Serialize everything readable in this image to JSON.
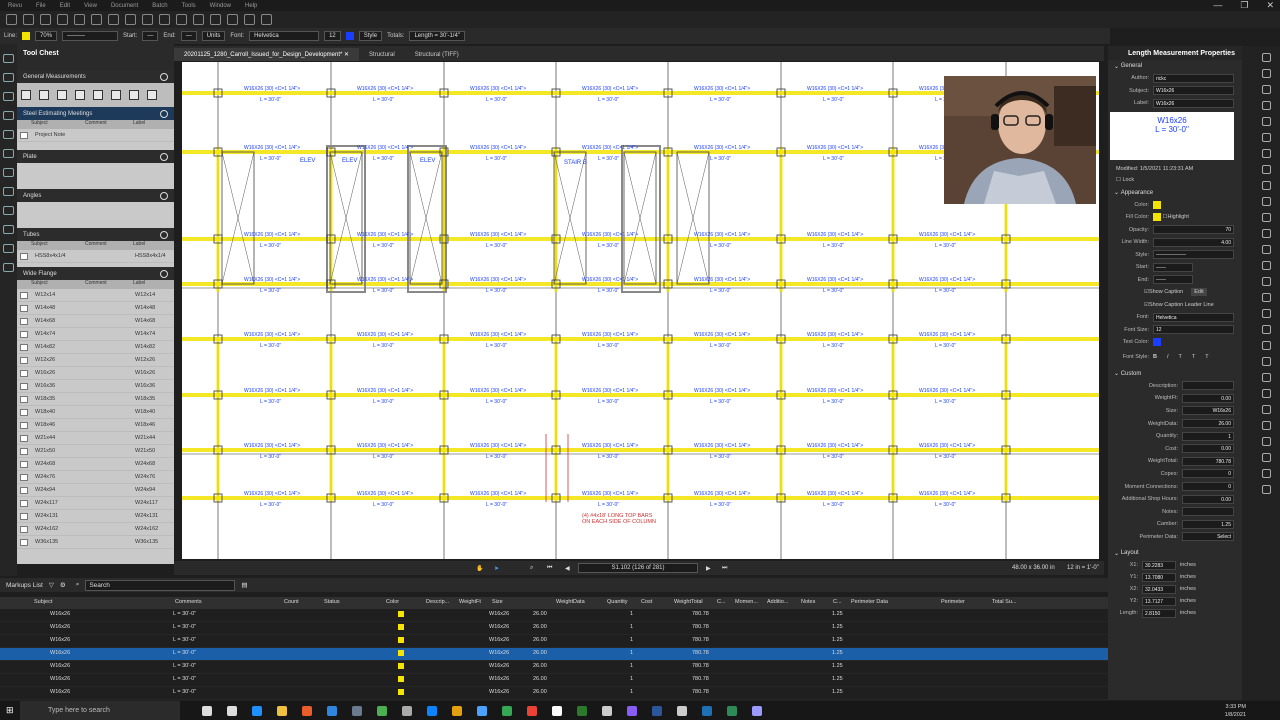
{
  "app": {
    "name": "Revu"
  },
  "menu": [
    "Revu",
    "File",
    "Edit",
    "View",
    "Document",
    "Batch",
    "Tools",
    "Window",
    "Help"
  ],
  "window": {
    "minimize": "—",
    "restore": "❐",
    "close": "✕"
  },
  "propbar": {
    "line_label": "Line:",
    "line_color": "#f2e400",
    "opacity": "70%",
    "start_label": "Start:",
    "end_label": "End:",
    "units": "Units",
    "font_label": "Font:",
    "font": "Helvetica",
    "font_size": "12",
    "style": "Style",
    "totals_label": "Totals:",
    "totals_value": "Length = 30'-1/4\""
  },
  "toolchest": {
    "title": "Tool Chest",
    "sections": [
      {
        "name": "General Measurements"
      },
      {
        "name": "Steel Estimating Meetings"
      },
      {
        "name": "Plate"
      },
      {
        "name": "Angles"
      },
      {
        "name": "Tubes"
      },
      {
        "name": "Wide Flange"
      }
    ],
    "col_subject": "Subject",
    "col_comment": "Comment",
    "col_label": "Label",
    "steel_rows": [
      {
        "subject": "Project Note",
        "label": ""
      }
    ],
    "tube_rows": [
      {
        "subject": "HSS8x4x1/4",
        "label": "HSS8x4x1/4"
      }
    ],
    "wf_rows": [
      {
        "subject": "W12x14",
        "label": "W12x14"
      },
      {
        "subject": "W14x48",
        "label": "W14x48"
      },
      {
        "subject": "W14x68",
        "label": "W14x68"
      },
      {
        "subject": "W14x74",
        "label": "W14x74"
      },
      {
        "subject": "W14x82",
        "label": "W14x82"
      },
      {
        "subject": "W12x26",
        "label": "W12x26"
      },
      {
        "subject": "W16x26",
        "label": "W16x26"
      },
      {
        "subject": "W16x36",
        "label": "W16x36"
      },
      {
        "subject": "W18x35",
        "label": "W18x35"
      },
      {
        "subject": "W18x40",
        "label": "W18x40"
      },
      {
        "subject": "W18x46",
        "label": "W18x46"
      },
      {
        "subject": "W21x44",
        "label": "W21x44"
      },
      {
        "subject": "W21x50",
        "label": "W21x50"
      },
      {
        "subject": "W24x68",
        "label": "W24x68"
      },
      {
        "subject": "W24x76",
        "label": "W24x76"
      },
      {
        "subject": "W24x94",
        "label": "W24x94"
      },
      {
        "subject": "W24x117",
        "label": "W24x117"
      },
      {
        "subject": "W24x131",
        "label": "W24x131"
      },
      {
        "subject": "W24x162",
        "label": "W24x162"
      },
      {
        "subject": "W36x135",
        "label": "W36x135"
      }
    ]
  },
  "tabs": [
    "20201125_1280_Carroll_Issued_for_Design_Development*",
    "Structural",
    "Structural (TIFF)"
  ],
  "drawing": {
    "beam_label": "W16X26 (30) <C=1 1/4\">",
    "length_label": "L = 30'-0\"",
    "note_line1": "(4) #4x18' LONG TOP BARS",
    "note_line2": "ON EACH SIDE OF COLUMN",
    "elev": "ELEV",
    "stair": "STAIR B"
  },
  "nav": {
    "page": "S1.102 (126 of 281)",
    "size": "48.00 x 36.00 in",
    "scale": "12 in = 1'-0\""
  },
  "props": {
    "title": "Length Measurement Properties",
    "general": "General",
    "author_label": "Author:",
    "author": "rickc",
    "subject_label": "Subject:",
    "subject": "W16x26",
    "label_label": "Label:",
    "label": "W16x26",
    "preview_line1": "W16x26",
    "preview_line2": "L = 30'-0\"",
    "modified": "Modified: 1/5/2021 11:23:31 AM",
    "lock": "Lock",
    "appearance": "Appearance",
    "color_label": "Color:",
    "color": "#f2e400",
    "fill_label": "Fill Color:",
    "highlight": "Highlight",
    "opacity_label": "Opacity:",
    "opacity": "70",
    "linewidth_label": "Line Width:",
    "linewidth": "4.00",
    "style_label": "Style:",
    "start_label": "Start:",
    "end_label": "End:",
    "caption": "Show Caption",
    "edit": "Edit",
    "leader": "Show Caption Leader Line",
    "font_label": "Font:",
    "font": "Helvetica",
    "fontsize_label": "Font Size:",
    "fontsize": "12",
    "textcolor_label": "Text Color:",
    "textcolor": "#1a3dff",
    "fontstyle_label": "Font Style:",
    "custom": "Custom",
    "custom_rows": [
      {
        "label": "Description:",
        "value": ""
      },
      {
        "label": "WeightFt:",
        "value": "0.00"
      },
      {
        "label": "Size:",
        "value": "W16x26"
      },
      {
        "label": "WeightData:",
        "value": "26.00"
      },
      {
        "label": "Quantity:",
        "value": "1"
      },
      {
        "label": "Cost:",
        "value": "0.00"
      },
      {
        "label": "WeightTotal:",
        "value": "780.78"
      },
      {
        "label": "Copes:",
        "value": "0"
      },
      {
        "label": "Moment Connections:",
        "value": "0"
      },
      {
        "label": "Additional Shop Hours:",
        "value": "0.00"
      },
      {
        "label": "Notes:",
        "value": ""
      },
      {
        "label": "Camber:",
        "value": "1.25"
      },
      {
        "label": "Perimeter Data:",
        "value": "Select"
      }
    ],
    "layout": "Layout",
    "layout_rows": [
      {
        "label": "X1:",
        "value": "30.2283",
        "unit": "inches"
      },
      {
        "label": "Y1:",
        "value": "13.7080",
        "unit": "inches"
      },
      {
        "label": "X2:",
        "value": "32.0433",
        "unit": "inches"
      },
      {
        "label": "Y2:",
        "value": "13.7127",
        "unit": "inches"
      },
      {
        "label": "Length:",
        "value": "2.8150",
        "unit": "inches"
      }
    ]
  },
  "markups": {
    "title": "Markups List",
    "search_placeholder": "Search",
    "columns": [
      "Subject",
      "Comments",
      "Count",
      "Status",
      "Color",
      "Descrip...",
      "WeightFt",
      "Size",
      "WeightData",
      "Quantity",
      "Cost",
      "WeightTotal",
      "C...",
      "Momen...",
      "Additio...",
      "Notes",
      "C...",
      "Perimeter Data",
      "Perimeter",
      "Total Su..."
    ],
    "rows": [
      {
        "subject": "W16x26",
        "comments": "L = 30'-0\"",
        "size": "W16x26",
        "wd": "26.00",
        "qty": "1",
        "wt": "780.78",
        "camber": "1.25",
        "sel": false
      },
      {
        "subject": "W16x26",
        "comments": "L = 30'-0\"",
        "size": "W16x26",
        "wd": "26.00",
        "qty": "1",
        "wt": "780.78",
        "camber": "1.25",
        "sel": false
      },
      {
        "subject": "W16x26",
        "comments": "L = 30'-0\"",
        "size": "W16x26",
        "wd": "26.00",
        "qty": "1",
        "wt": "780.78",
        "camber": "1.25",
        "sel": false
      },
      {
        "subject": "W16x26",
        "comments": "L = 30'-0\"",
        "size": "W16x26",
        "wd": "26.00",
        "qty": "1",
        "wt": "780.78",
        "camber": "1.25",
        "sel": true
      },
      {
        "subject": "W16x26",
        "comments": "L = 30'-0\"",
        "size": "W16x26",
        "wd": "26.00",
        "qty": "1",
        "wt": "780.78",
        "camber": "1.25",
        "sel": false
      },
      {
        "subject": "W16x26",
        "comments": "L = 30'-0\"",
        "size": "W16x26",
        "wd": "26.00",
        "qty": "1",
        "wt": "780.78",
        "camber": "1.25",
        "sel": false
      },
      {
        "subject": "W16x26",
        "comments": "L = 30'-0\"",
        "size": "W16x26",
        "wd": "26.00",
        "qty": "1",
        "wt": "780.78",
        "camber": "1.25",
        "sel": false
      }
    ]
  },
  "taskbar": {
    "search": "Type here to search",
    "time": "3:33 PM",
    "date": "1/8/2021"
  }
}
